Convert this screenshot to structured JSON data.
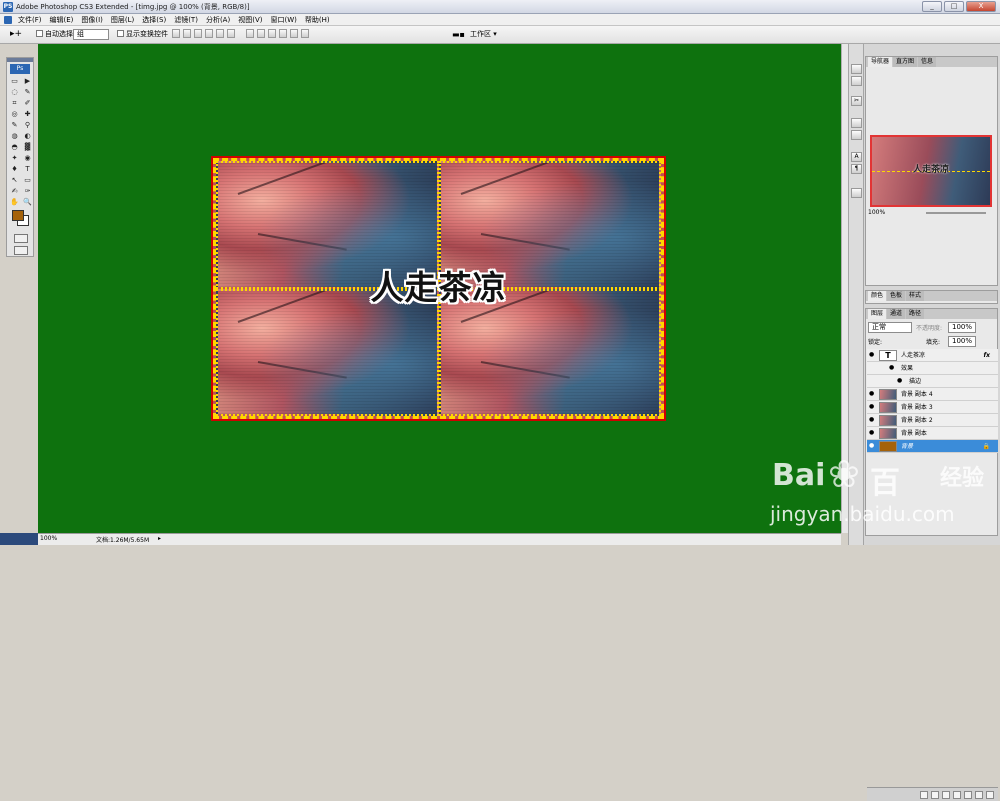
{
  "window": {
    "app_icon": "PS",
    "title": "Adobe Photoshop CS3 Extended - [timg.jpg @ 100% (背景, RGB/8)]",
    "buttons": [
      "_",
      "□",
      "X"
    ]
  },
  "menu": [
    "文件(F)",
    "编辑(E)",
    "图像(I)",
    "图层(L)",
    "选择(S)",
    "滤镜(T)",
    "分析(A)",
    "视图(V)",
    "窗口(W)",
    "帮助(H)"
  ],
  "options": {
    "auto_select_label": "自动选择:",
    "auto_select_value": "组",
    "show_transform_label": "显示变换控件",
    "workspace_label": "工作区 ▾"
  },
  "toolbox": {
    "badge": "Ps",
    "fg_color": "#a5620a",
    "bg_color": "#ffffff",
    "tools": [
      "▭",
      "▶",
      "◌",
      "✎",
      "⌗",
      "✐",
      "◎",
      "✚",
      "✎",
      "⚲",
      "◍",
      "◐",
      "◓",
      "▓",
      "✦",
      "◉",
      "♦",
      "T",
      "↖",
      "▭",
      "✍",
      "✑",
      "✋",
      "🔍"
    ]
  },
  "canvas": {
    "bg_color": "#0e720e",
    "overlay_text": "人走茶凉"
  },
  "status": {
    "zoom": "100%",
    "doc_info": "文档:1.26M/5.65M"
  },
  "navigator": {
    "tabs": [
      "导航器",
      "直方图",
      "信息"
    ],
    "zoom": "100%",
    "thumb_text": "人走茶凉"
  },
  "color_panel": {
    "tabs": [
      "颜色",
      "色板",
      "样式"
    ]
  },
  "layers_panel": {
    "tabs": [
      "图层",
      "通道",
      "路径"
    ],
    "blend_mode": "正常",
    "opacity_label": "不透明度:",
    "opacity": "100%",
    "lock_label": "锁定:",
    "fill_label": "填充:",
    "fill": "100%",
    "layers": [
      {
        "name": "人走茶凉",
        "thumb": "T",
        "fx": "fx",
        "selected": false
      },
      {
        "name": "效果",
        "thumb": "",
        "fx": "",
        "selected": false
      },
      {
        "name": "描边",
        "thumb": "",
        "fx": "",
        "selected": false
      },
      {
        "name": "背景 副本 4",
        "thumb": "img",
        "fx": "",
        "selected": false
      },
      {
        "name": "背景 副本 3",
        "thumb": "img",
        "fx": "",
        "selected": false
      },
      {
        "name": "背景 副本 2",
        "thumb": "img",
        "fx": "",
        "selected": false
      },
      {
        "name": "背景 副本",
        "thumb": "img",
        "fx": "",
        "selected": false
      },
      {
        "name": "背景",
        "thumb": "brown",
        "fx": "",
        "selected": true
      }
    ]
  },
  "watermark": {
    "brand": "Bai",
    "brand2": "百",
    "sub": "经验",
    "url": "jingyan.baidu.com"
  }
}
